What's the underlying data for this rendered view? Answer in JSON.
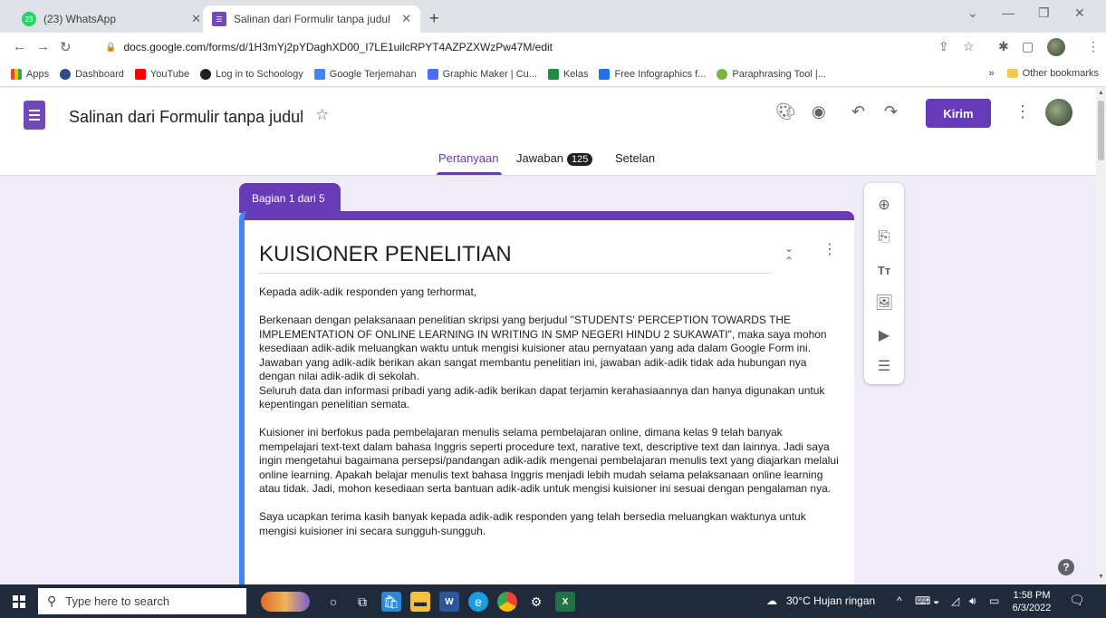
{
  "browser": {
    "tabs": [
      {
        "title": "(23) WhatsApp",
        "badge": "23",
        "active": false
      },
      {
        "title": "Salinan dari Formulir tanpa judul",
        "active": true
      }
    ],
    "url": "docs.google.com/forms/d/1H3mYj2pYDaghXD00_I7LE1uilcRPYT4AZPZXWzPw47M/edit",
    "bookmarks": [
      "Apps",
      "Dashboard",
      "YouTube",
      "Log in to Schoology",
      "Google Terjemahan",
      "Graphic Maker | Cu...",
      "Kelas",
      "Free Infographics f...",
      "Paraphrasing Tool |..."
    ],
    "more_bookmarks": "»",
    "other_bookmarks": "Other bookmarks"
  },
  "form_header": {
    "title": "Salinan dari Formulir tanpa judul",
    "send_label": "Kirim",
    "tabs": [
      {
        "label": "Pertanyaan",
        "active": true
      },
      {
        "label": "Jawaban",
        "count": "125"
      },
      {
        "label": "Setelan"
      }
    ]
  },
  "section": {
    "tag": "Bagian 1 dari 5",
    "title": "KUISIONER PENELITIAN",
    "paragraphs": [
      "Kepada adik-adik responden yang terhormat,",
      "Berkenaan dengan pelaksanaan penelitian skripsi yang berjudul \"STUDENTS' PERCEPTION TOWARDS THE IMPLEMENTATION OF ONLINE LEARNING IN WRITING IN SMP NEGERI HINDU 2 SUKAWATI\", maka saya mohon kesediaan adik-adik meluangkan waktu untuk mengisi kuisioner atau pernyataan yang ada dalam Google Form ini. Jawaban yang adik-adik berikan akan sangat membantu penelitian ini, jawaban adik-adik tidak ada hubungan nya dengan nilai adik-adik di sekolah.",
      "Seluruh data dan informasi pribadi yang adik-adik berikan dapat terjamin kerahasiaannya dan hanya digunakan untuk kepentingan penelitian semata.",
      "Kuisioner ini berfokus pada pembelajaran menulis selama pembelajaran online, dimana kelas 9 telah banyak mempelajari text-text dalam bahasa Inggris seperti procedure text, narative text, descriptive text dan lainnya. Jadi saya ingin mengetahui bagaimana persepsi/pandangan adik-adik mengenai pembelajaran menulis text yang diajarkan melalui online learning. Apakah belajar menulis text bahasa Inggris menjadi lebih mudah selama pelaksanaan online learning atau tidak. Jadi, mohon kesediaan serta bantuan adik-adik untuk mengisi kuisioner ini sesuai dengan pengalaman nya.",
      "Saya ucapkan terima kasih banyak kepada adik-adik responden yang telah bersedia meluangkan waktunya untuk mengisi kuisioner ini secara sungguh-sungguh."
    ]
  },
  "taskbar": {
    "search_placeholder": "Type here to search",
    "weather": "30°C  Hujan ringan",
    "time": "1:58 PM",
    "date": "6/3/2022"
  }
}
